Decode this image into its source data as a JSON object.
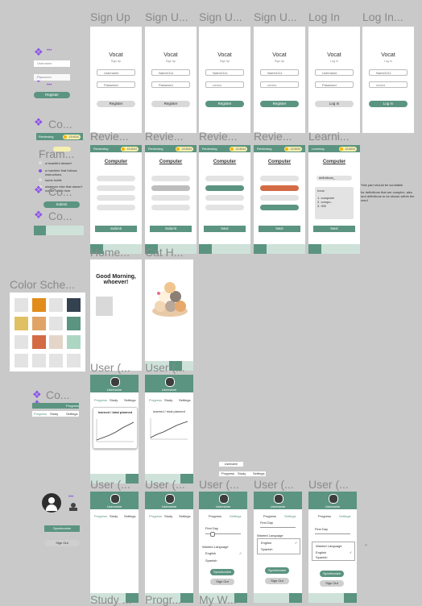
{
  "labels": {
    "sign_up": "Sign Up",
    "sign_up_2": "Sign U...",
    "sign_up_3": "Sign U...",
    "sign_up_4": "Sign U...",
    "log_in": "Log In",
    "log_in_2": "Log In...",
    "review_1": "Revie...",
    "review_2": "Revie...",
    "review_3": "Revie...",
    "review_4": "Revie...",
    "learning": "Learni...",
    "home": "Home...",
    "cat_home": "Cat H...",
    "color_scheme": "Color Sche...",
    "user_1": "User (...",
    "user_2": "User (...",
    "user_3": "User (...",
    "user_4": "User (...",
    "user_5": "User (...",
    "user_6": "User (...",
    "user_7": "User (...",
    "study": "Study ...",
    "progress": "Progr...",
    "my_words": "My W...",
    "component_1": "Co...",
    "component_2": "Co...",
    "component_3": "Co...",
    "component_4": "Co...",
    "frame": "Fram..."
  },
  "auth": {
    "app_name": "Vocat",
    "sign_up_sub": "Sign Up",
    "log_in_sub": "Log In",
    "username_ph": "Username",
    "password_ph": "Password",
    "filled_user": "Name1111",
    "filled_pass": "••••••••",
    "register": "Register",
    "log_in": "Log In"
  },
  "review": {
    "status": "Reviewing",
    "learning": "Learning",
    "count": "12/4534",
    "title": "Computer",
    "submit": "Submit",
    "next": "Next",
    "definitions": "definitions_",
    "learn_lines": [
      "noun",
      "1. computer",
      "2. compu..",
      "3. 000"
    ],
    "side_note_1": "*this part should be scrollable",
    "side_note_2": "for definitions that are complex, also\nand definitions to be shown within the word"
  },
  "home": {
    "greeting": "Good Morning,\nwhoever!"
  },
  "user": {
    "name": "Username",
    "tab_progress": "Progress",
    "tab_study": "Study",
    "tab_settings": "Settings",
    "chart_title": "learned / total planned",
    "first_lang": "First Day",
    "wanted_lang": "Wanted Language",
    "english": "English",
    "spanish": "Spanish",
    "sync": "Synchronize",
    "sign_out": "Sign Out",
    "check": "✓"
  },
  "component": {
    "reviewing": "Reviewing",
    "count": "12/4534",
    "register": "Register",
    "choices": [
      "a beautiful dessert",
      "a machine that follows\ninstructions",
      "some bottle",
      "whatever else that doesn't\nmatter much here"
    ],
    "submit": "Submit",
    "username": "Username",
    "password": "Password",
    "tab_progress": "Progress",
    "tab_study": "Study",
    "tab_settings": "Settings",
    "mini_bar": "Progress"
  },
  "colors": {
    "primary": "#5b9480",
    "accent": "#f2b600",
    "swatches": [
      "#e3e3e3",
      "#e28c1b",
      "#e3e3e3",
      "#34424f",
      "#dfc163",
      "#e0a466",
      "#e3e3e3",
      "#5b9480",
      "#e3e3e3",
      "#d36b45",
      "#e3d6c9",
      "#acd6c2",
      "#e3e3e3",
      "#e3e3e3",
      "#e3e3e3",
      "#e3e3e3"
    ]
  }
}
